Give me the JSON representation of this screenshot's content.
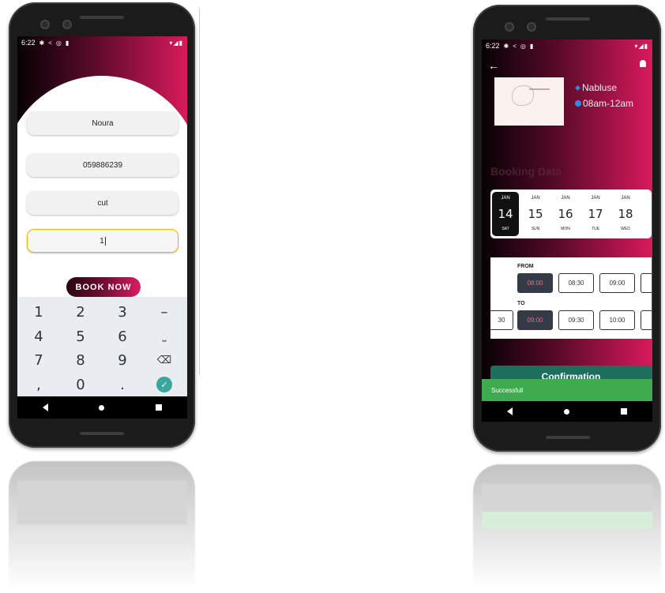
{
  "left_phone": {
    "status_time": "6:22",
    "name_value": "Noura",
    "phone_value": "059886239",
    "service_value": "cut",
    "quantity_value": "1",
    "book_label": "BOOK NOW",
    "keys": [
      "1",
      "2",
      "3",
      "–",
      "4",
      "5",
      "6",
      "⎵",
      "7",
      "8",
      "9",
      "⌫",
      ",",
      "0",
      ".",
      "✓"
    ]
  },
  "right_phone": {
    "status_time": "6:22",
    "location": "Nabluse",
    "hours": "08am-12am",
    "booking_date_label": "Booking Date",
    "days": [
      {
        "month": "JAN",
        "day": "14",
        "weekday": "SAT",
        "selected": true
      },
      {
        "month": "JAN",
        "day": "15",
        "weekday": "SUN",
        "selected": false
      },
      {
        "month": "JAN",
        "day": "16",
        "weekday": "MON",
        "selected": false
      },
      {
        "month": "JAN",
        "day": "17",
        "weekday": "TUE",
        "selected": false
      },
      {
        "month": "JAN",
        "day": "18",
        "weekday": "WED",
        "selected": false
      }
    ],
    "from_label": "FROM",
    "to_label": "TO",
    "from_slots": [
      "08:00",
      "08:30",
      "09:00"
    ],
    "from_selected": "08:00",
    "to_slots": [
      "30",
      "09:00",
      "09:30",
      "10:00"
    ],
    "to_selected": "09:00",
    "confirm_label": "Confirmation",
    "snackbar": "Successfull"
  },
  "colors": {
    "accent": "#d91a5b",
    "dark": "#070204",
    "snackbar": "#3fab4f",
    "selected_slot": "#343b46"
  }
}
